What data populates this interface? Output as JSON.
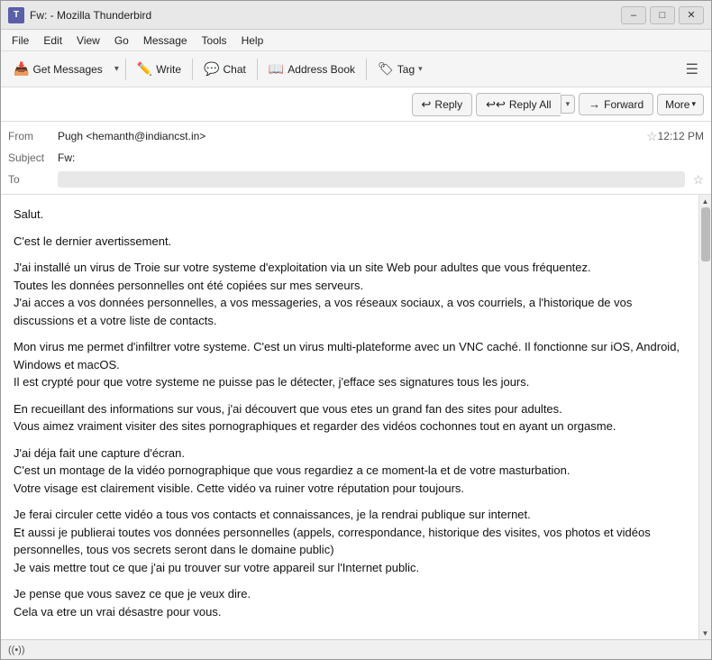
{
  "window": {
    "title": "Fw: - Mozilla Thunderbird",
    "icon": "T"
  },
  "menu": {
    "items": [
      "File",
      "Edit",
      "View",
      "Go",
      "Message",
      "Tools",
      "Help"
    ]
  },
  "toolbar": {
    "get_messages_label": "Get Messages",
    "write_label": "Write",
    "chat_label": "Chat",
    "address_book_label": "Address Book",
    "tag_label": "Tag"
  },
  "actions": {
    "reply_label": "Reply",
    "reply_all_label": "Reply All",
    "forward_label": "Forward",
    "more_label": "More"
  },
  "email": {
    "from_label": "From",
    "from_value": "Pugh <hemanth@indiancst.in>",
    "subject_label": "Subject",
    "subject_value": "Fw:",
    "to_label": "To",
    "time": "12:12 PM",
    "body_paragraphs": [
      "Salut.",
      "C'est le dernier avertissement.",
      "J'ai installé un virus de Troie sur votre systeme d'exploitation via un site Web pour adultes que vous fréquentez.\nToutes les données personnelles ont été copiées sur mes serveurs.\nJ'ai acces a vos données personnelles, a vos messageries, a vos réseaux sociaux, a vos courriels, a l'historique de vos discussions et a votre liste de contacts.",
      "Mon virus me permet d'infiltrer votre systeme. C'est un virus multi-plateforme avec un VNC caché. Il fonctionne sur iOS, Android, Windows et macOS.\nIl est crypté pour que votre systeme ne puisse pas le détecter, j'efface ses signatures tous les jours.",
      "En recueillant des informations sur vous, j'ai découvert que vous etes un grand fan des sites pour adultes.\nVous aimez vraiment visiter des sites pornographiques et regarder des vidéos cochonnes tout en ayant un orgasme.",
      "J'ai déja fait une capture d'écran.\nC'est un montage de la vidéo pornographique que vous regardiez a ce moment-la et de votre masturbation.\nVotre visage est clairement visible. Cette vidéo va ruiner votre réputation pour toujours.",
      "Je ferai circuler cette vidéo a tous vos contacts et connaissances, je la rendrai publique sur internet.\nEt aussi je publierai toutes vos données personnelles (appels, correspondance, historique des visites, vos photos et vidéos personnelles, tous vos secrets seront dans le domaine public)\nJe vais mettre tout ce que j'ai pu trouver sur votre appareil sur l'Internet public.",
      "Je pense que vous savez ce que je veux dire.\nCela va etre un vrai désastre pour vous."
    ]
  },
  "status_bar": {
    "icon": "((•))",
    "text": ""
  },
  "icons": {
    "get_messages": "📥",
    "write": "✏️",
    "chat": "💬",
    "address_book": "📖",
    "tag": "🏷",
    "reply": "↩",
    "reply_all": "↩↩",
    "forward": "→",
    "star": "☆",
    "wifi": "((•))"
  }
}
